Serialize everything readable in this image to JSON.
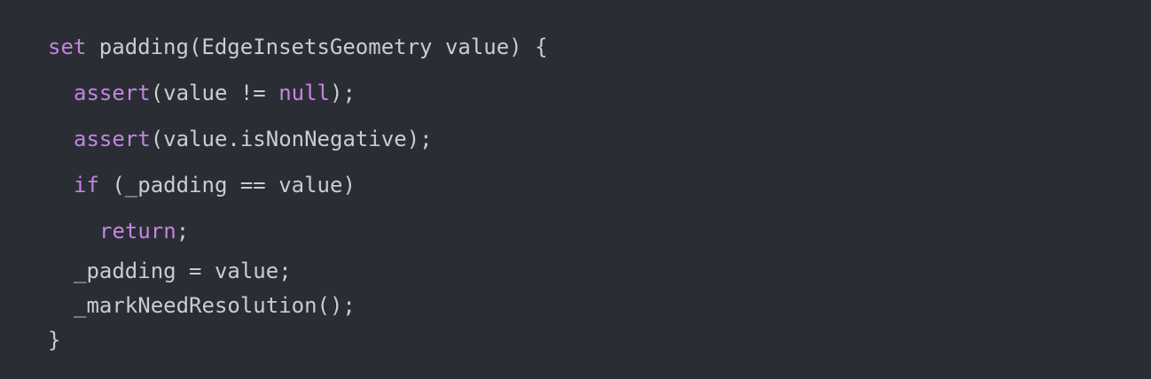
{
  "colors": {
    "background": "#2b2d35",
    "text": "#c9ccd3",
    "keyword": "#c285e0"
  },
  "code": {
    "line1": {
      "keyword": "set",
      "rest": " padding(EdgeInsetsGeometry value) {"
    },
    "line2": {
      "keyword": "assert",
      "middle": "(value != ",
      "keyword2": "null",
      "rest": ");"
    },
    "line3": {
      "keyword": "assert",
      "rest": "(value.isNonNegative);"
    },
    "line4": {
      "keyword": "if",
      "rest": " (_padding == value)"
    },
    "line5": {
      "keyword": "return",
      "rest": ";"
    },
    "line6": {
      "text": "_padding = value;"
    },
    "line7": {
      "text": "_markNeedResolution();"
    },
    "line8": {
      "text": "}"
    }
  }
}
